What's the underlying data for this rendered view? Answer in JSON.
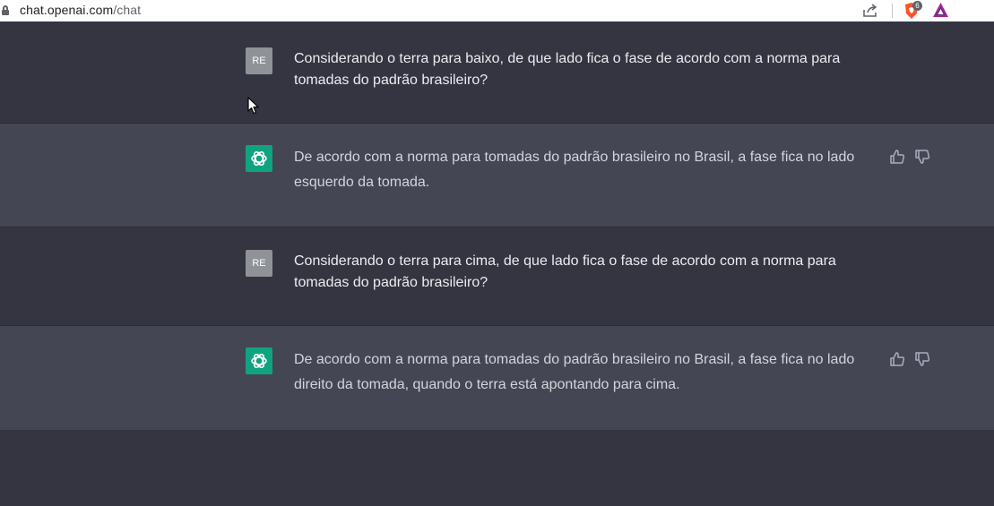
{
  "browser": {
    "url_host": "chat.openai.com",
    "url_path": "/chat",
    "extension_badge": "6"
  },
  "conversation": [
    {
      "role": "user",
      "avatar": "RE",
      "text": "Considerando o terra para baixo, de que lado fica o fase de acordo com a norma para tomadas do padrão brasileiro?"
    },
    {
      "role": "assistant",
      "text": "De acordo com a norma para tomadas do padrão brasileiro no Brasil, a fase fica no lado esquerdo da tomada."
    },
    {
      "role": "user",
      "avatar": "RE",
      "text": "Considerando o terra para cima, de que lado fica o fase de acordo com a norma para tomadas do padrão brasileiro?"
    },
    {
      "role": "assistant",
      "text": "De acordo com a norma para tomadas do padrão brasileiro no Brasil, a fase fica no lado direito da tomada, quando o terra está apontando para cima."
    }
  ],
  "colors": {
    "user_row": "#343541",
    "assistant_row": "#444654",
    "assistant_avatar": "#10a37f",
    "user_avatar": "#8f9398"
  }
}
